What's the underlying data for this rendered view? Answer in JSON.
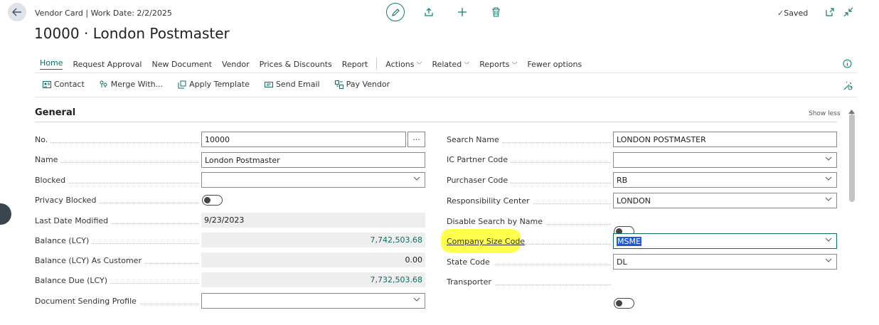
{
  "header": {
    "breadcrumb": "Vendor Card | Work Date: 2/2/2025",
    "title": "10000 · London Postmaster",
    "saved_label": "Saved"
  },
  "action_bar": {
    "tabs": [
      "Home",
      "Request Approval",
      "New Document",
      "Vendor",
      "Prices & Discounts",
      "Report"
    ],
    "dropdown_menus": [
      "Actions",
      "Related",
      "Reports"
    ],
    "fewer_options": "Fewer options"
  },
  "promoted_actions": {
    "contact": "Contact",
    "merge_with": "Merge With...",
    "apply_template": "Apply Template",
    "send_email": "Send Email",
    "pay_vendor": "Pay Vendor"
  },
  "section": {
    "title": "General",
    "show_less": "Show less"
  },
  "left_fields": {
    "no": {
      "label": "No.",
      "value": "10000",
      "ellipsis": "···"
    },
    "name": {
      "label": "Name",
      "value": "London Postmaster"
    },
    "blocked": {
      "label": "Blocked",
      "value": ""
    },
    "privacy_blocked": {
      "label": "Privacy Blocked"
    },
    "last_date_modified": {
      "label": "Last Date Modified",
      "value": "9/23/2023"
    },
    "balance_lcy": {
      "label": "Balance (LCY)",
      "value": "7,742,503.68"
    },
    "balance_lcy_customer": {
      "label": "Balance (LCY) As Customer",
      "value": "0.00"
    },
    "balance_due_lcy": {
      "label": "Balance Due (LCY)",
      "value": "7,732,503.68"
    },
    "doc_sending_profile": {
      "label": "Document Sending Profile",
      "value": ""
    }
  },
  "right_fields": {
    "search_name": {
      "label": "Search Name",
      "value": "LONDON POSTMASTER"
    },
    "ic_partner_code": {
      "label": "IC Partner Code",
      "value": ""
    },
    "purchaser_code": {
      "label": "Purchaser Code",
      "value": "RB"
    },
    "responsibility_center": {
      "label": "Responsibility Center",
      "value": "LONDON"
    },
    "disable_search_by_name": {
      "label": "Disable Search by Name"
    },
    "company_size_code": {
      "label": "Company Size Code",
      "value": "MSME"
    },
    "state_code": {
      "label": "State Code",
      "value": "DL"
    },
    "transporter": {
      "label": "Transporter"
    }
  },
  "colors": {
    "accent": "#0f6c64",
    "highlight": "#ffff44",
    "selection": "#1e5bd6"
  }
}
